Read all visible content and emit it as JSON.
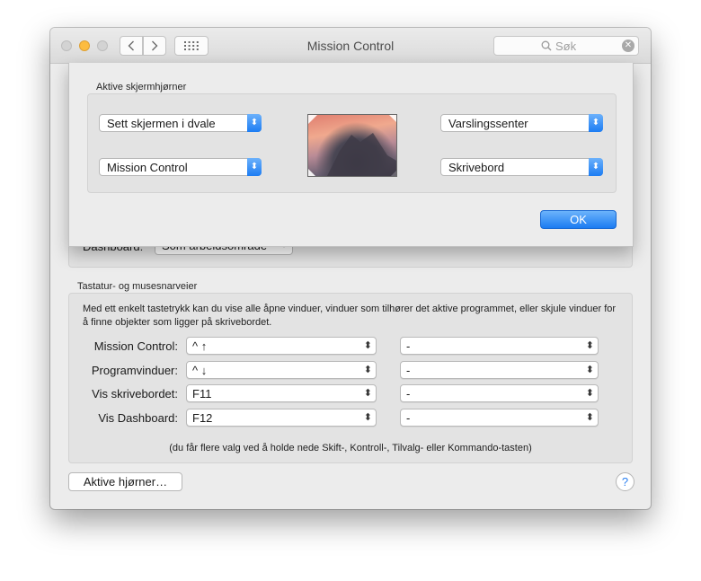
{
  "window": {
    "title": "Mission Control",
    "search_placeholder": "Søk"
  },
  "dashboard": {
    "label": "Dashboard:",
    "value": "Som arbeidsområde"
  },
  "shortcuts": {
    "group_label": "Tastatur- og musesnarveier",
    "hint": "Med ett enkelt tastetrykk kan du vise alle åpne vinduer, vinduer som tilhører det aktive programmet, eller skjule vinduer for å finne objekter som ligger på skrivebordet.",
    "rows": [
      {
        "label": "Mission Control:",
        "key": "^ ↑",
        "mouse": "-"
      },
      {
        "label": "Programvinduer:",
        "key": "^ ↓",
        "mouse": "-"
      },
      {
        "label": "Vis skrivebordet:",
        "key": "F11",
        "mouse": "-"
      },
      {
        "label": "Vis Dashboard:",
        "key": "F12",
        "mouse": "-"
      }
    ],
    "footnote": "(du får flere valg ved å holde nede Skift-, Kontroll-, Tilvalg- eller Kommando-tasten)"
  },
  "buttons": {
    "hot_corners": "Aktive hjørner…",
    "help": "?",
    "ok": "OK"
  },
  "sheet": {
    "group_label": "Aktive skjermhjørner",
    "top_left": "Sett skjermen i dvale",
    "bottom_left": "Mission Control",
    "top_right": "Varslingssenter",
    "bottom_right": "Skrivebord"
  },
  "colors": {
    "accent": "#1b7cf2",
    "minimize_light": "#fdbc40"
  }
}
